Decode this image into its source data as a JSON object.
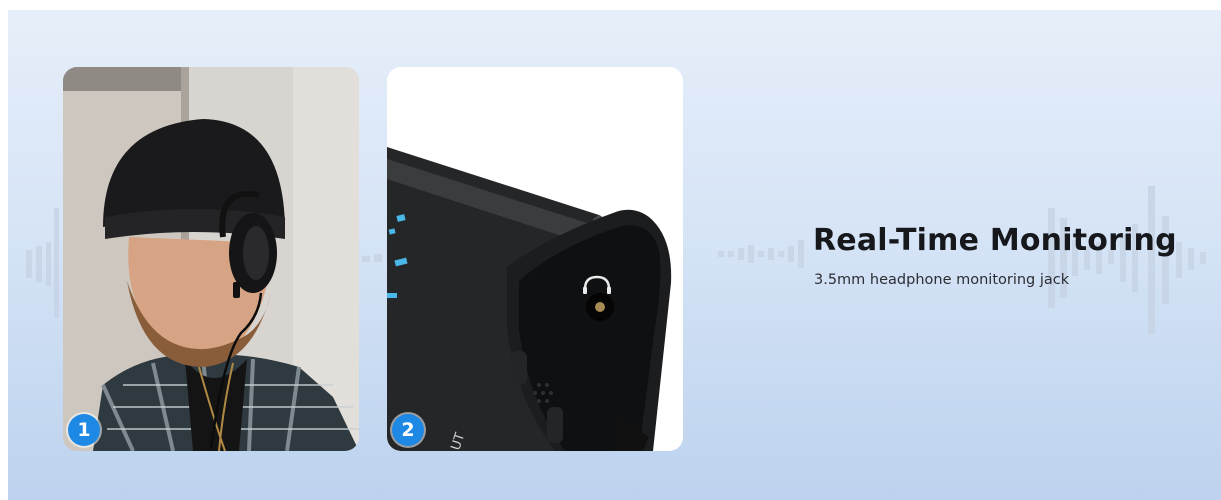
{
  "feature": {
    "title": "Real-Time Monitoring",
    "subtitle": "3.5mm headphone monitoring jack"
  },
  "cards": [
    {
      "badge": "1",
      "image": "man-wearing-headphones-photo"
    },
    {
      "badge": "2",
      "image": "headphone-jack-closeup-photo"
    }
  ],
  "colors": {
    "background_top": "#e6eef9",
    "background_bottom": "#bcd2ee",
    "badge": "#1e88e5",
    "title": "#16181c"
  }
}
